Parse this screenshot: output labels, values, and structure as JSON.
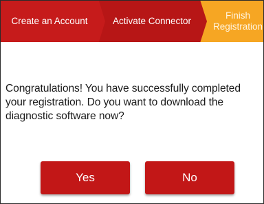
{
  "steps": [
    {
      "label": "Create an Account",
      "state": "completed"
    },
    {
      "label": "Activate Connector",
      "state": "completed"
    },
    {
      "label": "Finish Registration",
      "state": "current"
    }
  ],
  "dialog": {
    "message": "Congratulations! You have successfully completed your registration. Do you want to download the diagnostic software now?",
    "yes_label": "Yes",
    "no_label": "No"
  },
  "colors": {
    "step_completed": "#c61b1b",
    "step_current": "#f6a623",
    "button": "#c21717"
  }
}
